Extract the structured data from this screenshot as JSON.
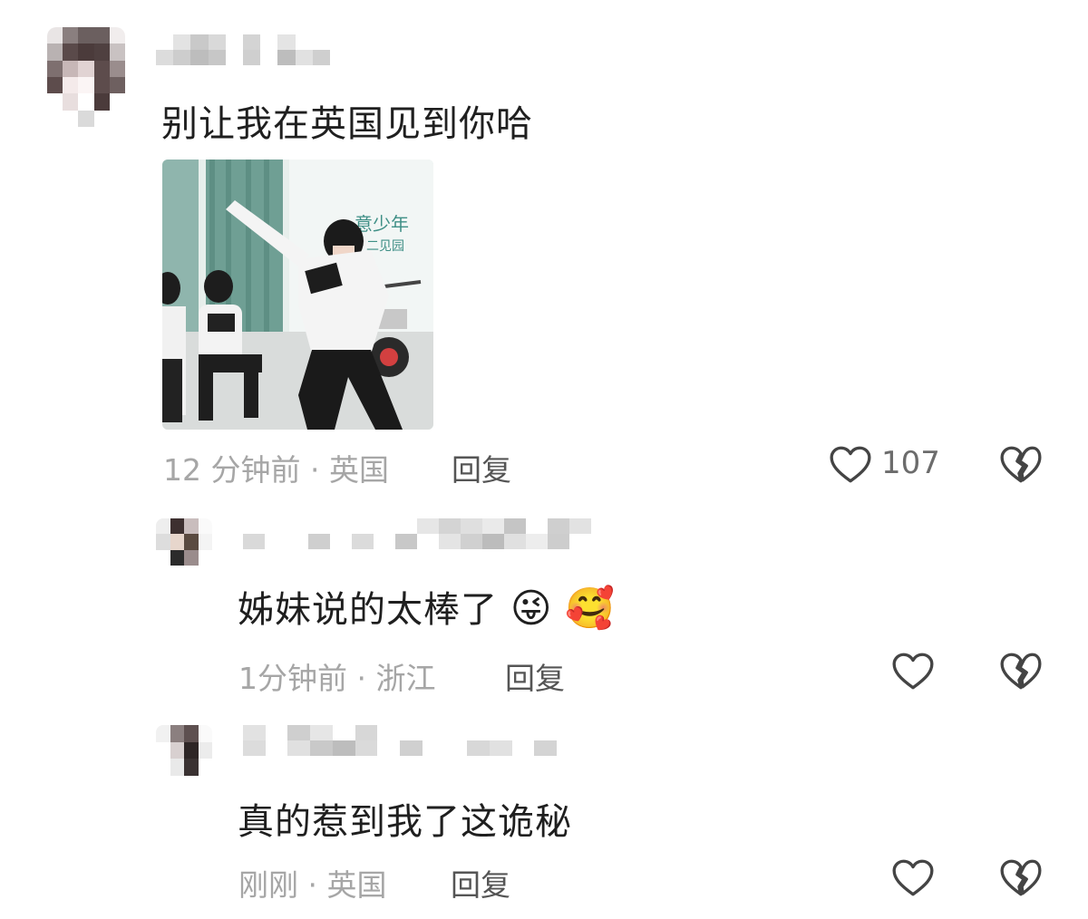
{
  "comments": [
    {
      "text": "别让我在英国见到你哈",
      "time": "12 分钟前 · 英国",
      "reply_label": "回复",
      "like_count": "107",
      "image": {
        "banner_text": "意少年",
        "banner_sub": "二见园"
      }
    },
    {
      "text": "姊妹说的太棒了",
      "emojis": [
        "😜",
        "🥰"
      ],
      "time": "1分钟前 · 浙江",
      "reply_label": "回复"
    },
    {
      "text": "真的惹到我了这诡秘",
      "time": "刚刚 · 英国",
      "reply_label": "回复"
    }
  ],
  "icons": {
    "like": "heart-outline-icon",
    "dislike": "broken-heart-icon"
  },
  "colors": {
    "text": "#1f1f1f",
    "meta": "#a6a6a6",
    "icon": "#444444"
  }
}
